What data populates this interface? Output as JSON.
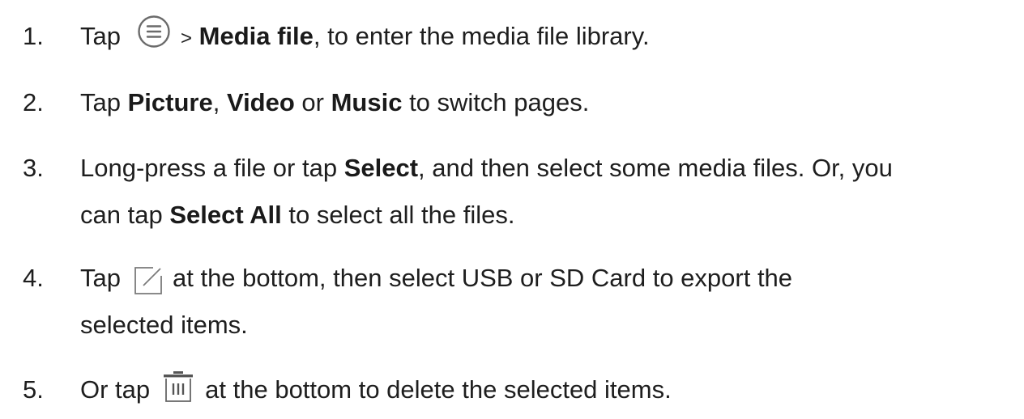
{
  "steps": [
    {
      "number": "1.",
      "pre": "Tap",
      "icon": "menu-icon",
      "gt": ">",
      "bold1": "Media file",
      "post": ", to enter the media file library."
    },
    {
      "number": "2.",
      "pre": "Tap ",
      "bold1": "Picture",
      "mid1": ", ",
      "bold2": "Video",
      "mid2": " or ",
      "bold3": "Music",
      "post": " to switch pages."
    },
    {
      "number": "3.",
      "pre": "Long-press a file or tap ",
      "bold1": "Select",
      "post": ", and then select some media files. Or, you",
      "line2_pre": "can tap ",
      "bold2": "Select All",
      "line2_post": " to select all the files."
    },
    {
      "number": "4.",
      "pre": "Tap",
      "icon": "export-icon",
      "post": "at the bottom, then select USB or SD Card to export the",
      "line2": "selected items."
    },
    {
      "number": "5.",
      "pre": "Or tap",
      "icon": "trash-icon",
      "post": "at the bottom to delete the selected items."
    }
  ],
  "colors": {
    "text": "#1e1e1e",
    "icon": "#6b6b6b"
  }
}
